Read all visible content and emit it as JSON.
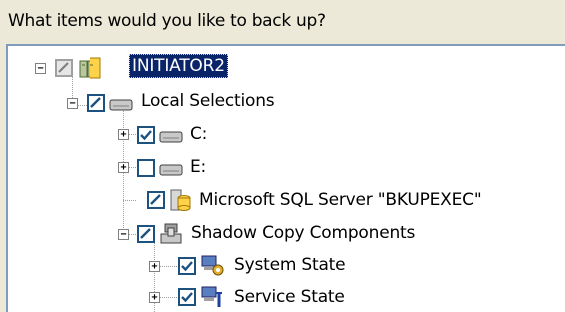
{
  "prompt": "What items would you like to back up?",
  "tree": [
    {
      "label": "INITIATOR2",
      "check": "partial",
      "expander": "−",
      "icon": "server-icon",
      "selected": true
    },
    {
      "label": "Local Selections",
      "check": "checked",
      "expander": "−",
      "icon": "drive-icon"
    },
    {
      "label": "C:",
      "check": "checked",
      "expander": "+",
      "icon": "drive-icon"
    },
    {
      "label": "E:",
      "check": "unchecked",
      "expander": "+",
      "icon": "drive-icon"
    },
    {
      "label": "Microsoft SQL Server \"BKUPEXEC\"",
      "check": "partial",
      "expander": "",
      "icon": "database-icon"
    },
    {
      "label": "Shadow Copy Components",
      "check": "partial",
      "expander": "−",
      "icon": "shadow-copy-icon"
    },
    {
      "label": "System State",
      "check": "checked",
      "expander": "+",
      "icon": "system-state-icon"
    },
    {
      "label": "Service State",
      "check": "checked",
      "expander": "+",
      "icon": "service-state-icon"
    }
  ],
  "colors": {
    "selection": "#0a246a",
    "checkmark": "#1c5180",
    "tree_lines": "#a0a0a0"
  }
}
